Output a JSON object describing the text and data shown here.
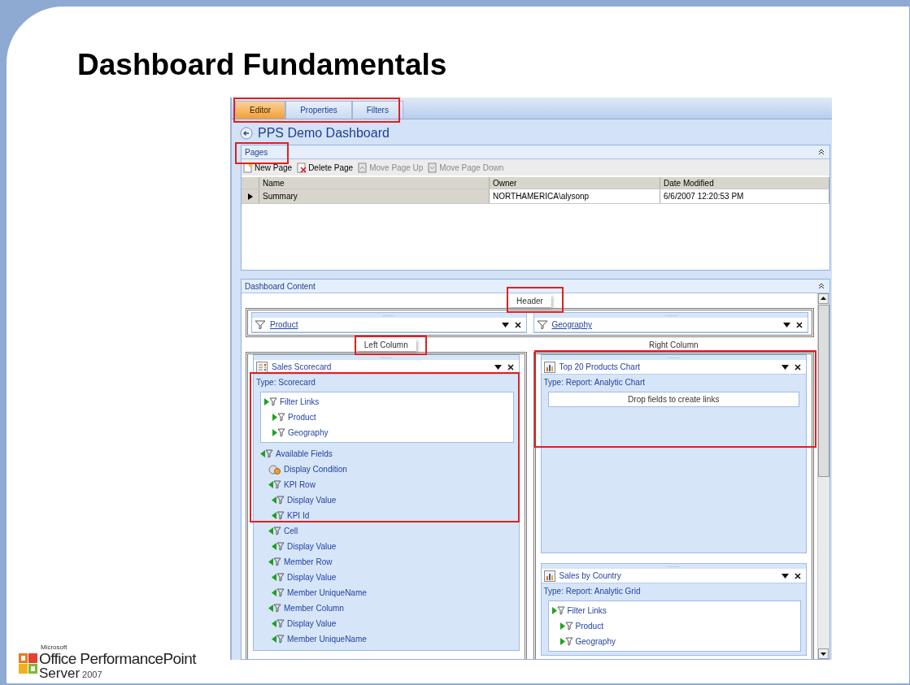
{
  "slide": {
    "title": "Dashboard Fundamentals"
  },
  "logo": {
    "maker": "Microsoft",
    "product": "Office PerformancePoint",
    "edition": "Server",
    "year": "2007"
  },
  "editor": {
    "tabs": [
      {
        "label": "Editor",
        "selected": true
      },
      {
        "label": "Properties",
        "selected": false
      },
      {
        "label": "Filters",
        "selected": false
      }
    ],
    "title": "PPS Demo Dashboard",
    "pages": {
      "title": "Pages",
      "toolbar": [
        {
          "label": "New Page",
          "kind": "new",
          "disabled": false
        },
        {
          "label": "Delete Page",
          "kind": "delete",
          "disabled": false
        },
        {
          "label": "Move Page Up",
          "kind": "up",
          "disabled": true
        },
        {
          "label": "Move Page Down",
          "kind": "down",
          "disabled": true
        }
      ],
      "columns": [
        "Name",
        "Owner",
        "Date Modified"
      ],
      "rows": [
        {
          "cells": [
            "Summary",
            "NORTHAMERICA\\alysonp",
            "6/6/2007 12:20:53 PM"
          ],
          "selected": true
        }
      ]
    },
    "content": {
      "title": "Dashboard Content",
      "header_zone": {
        "label": "Header",
        "parts": [
          {
            "title": "Product",
            "kind": "filter"
          },
          {
            "title": "Geography",
            "kind": "filter"
          }
        ]
      },
      "columns": [
        {
          "label": "Left Column",
          "parts": [
            {
              "title": "Sales Scorecard",
              "kind": "scorecard",
              "type": "Type:  Scorecard",
              "filter_links": {
                "label": "Filter Links",
                "kind": "source",
                "children": [
                  {
                    "label": "Product",
                    "kind": "source"
                  },
                  {
                    "label": "Geography",
                    "kind": "source"
                  }
                ]
              },
              "fields": [
                {
                  "label": "Available Fields",
                  "kind": "field",
                  "children": [
                    {
                      "label": "Display Condition",
                      "kind": "condition"
                    },
                    {
                      "label": "KPI Row",
                      "kind": "field",
                      "children": [
                        {
                          "label": "Display Value",
                          "kind": "field"
                        },
                        {
                          "label": "KPI Id",
                          "kind": "field"
                        }
                      ]
                    },
                    {
                      "label": "Cell",
                      "kind": "field",
                      "children": [
                        {
                          "label": "Display Value",
                          "kind": "field"
                        }
                      ]
                    },
                    {
                      "label": "Member Row",
                      "kind": "field",
                      "children": [
                        {
                          "label": "Display Value",
                          "kind": "field"
                        },
                        {
                          "label": "Member UniqueName",
                          "kind": "field"
                        }
                      ]
                    },
                    {
                      "label": "Member Column",
                      "kind": "field",
                      "children": [
                        {
                          "label": "Display Value",
                          "kind": "field"
                        },
                        {
                          "label": "Member UniqueName",
                          "kind": "field"
                        }
                      ]
                    }
                  ]
                }
              ]
            }
          ]
        },
        {
          "label": "Right Column",
          "parts": [
            {
              "title": "Top 20 Products Chart",
              "kind": "report",
              "type": "Type:  Report: Analytic Chart",
              "drop_hint": "Drop fields to create links"
            },
            {
              "title": "Sales by Country",
              "kind": "report",
              "type": "Type:  Report: Analytic Grid",
              "filter_links": {
                "label": "Filter Links",
                "kind": "source",
                "children": [
                  {
                    "label": "Product",
                    "kind": "source"
                  },
                  {
                    "label": "Geography",
                    "kind": "source"
                  }
                ]
              }
            }
          ]
        }
      ]
    }
  }
}
